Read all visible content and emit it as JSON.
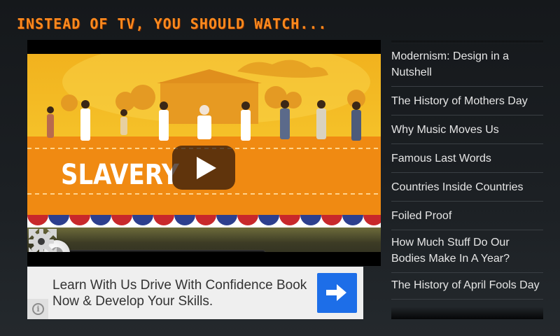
{
  "header": {
    "title": "INSTEAD OF TV, YOU SHOULD WATCH..."
  },
  "video": {
    "caption_text": "SLAVERY",
    "progress": 0.0,
    "controls": {
      "play_icon": "play-icon",
      "settings_icon": "gear-icon",
      "fullscreen_icon": "expand-icon"
    }
  },
  "ad": {
    "text": "Learn With Us Drive With Confidence Book Now & Develop Your Skills.",
    "button_icon": "arrow-right-icon",
    "info_icon": "info-icon",
    "accent_color": "#1d6ee8"
  },
  "sidebar": {
    "items": [
      {
        "label": "Modernism: Design in a Nutshell"
      },
      {
        "label": "The History of Mothers Day"
      },
      {
        "label": "Why Music Moves Us"
      },
      {
        "label": "Famous Last Words"
      },
      {
        "label": "Countries Inside Countries"
      },
      {
        "label": "Foiled Proof"
      },
      {
        "label": "How Much Stuff Do Our Bodies Make In A Year?"
      },
      {
        "label": "The History of April Fools Day"
      }
    ]
  },
  "colors": {
    "header_orange": "#ff8a1e",
    "background": "#1c2024"
  }
}
